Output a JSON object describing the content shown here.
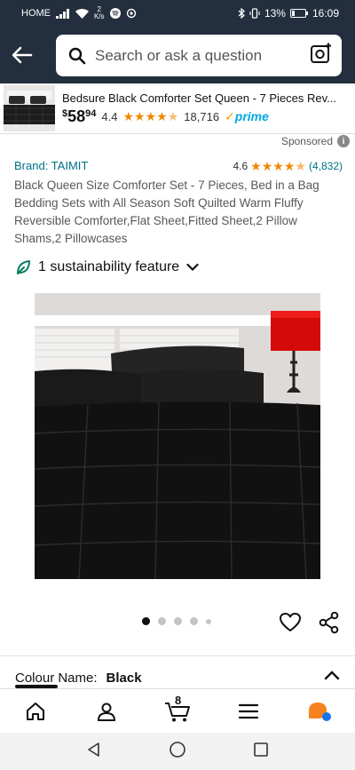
{
  "status_bar": {
    "carrier": "HOME",
    "net_speed_value": "2",
    "net_speed_unit": "K/s",
    "battery": "13%",
    "time": "16:09"
  },
  "search": {
    "placeholder": "Search or ask a question"
  },
  "sticky_product": {
    "title": "Bedsure Black Comforter Set Queen - 7 Pieces Rev...",
    "price_currency": "$",
    "price_whole": "58",
    "price_fraction": "94",
    "rating": "4.4",
    "rating_value": 4.4,
    "review_count": "18,716",
    "prime_label": "prime"
  },
  "sponsored": {
    "label": "Sponsored"
  },
  "product": {
    "brand": "Brand: TAIMIT",
    "rating": "4.6",
    "rating_value": 4.6,
    "review_count": "(4,832)",
    "title": "Black Queen Size Comforter Set - 7 Pieces, Bed in a Bag Bedding Sets with All Season Soft Quilted Warm Fluffy Reversible Comforter,Flat Sheet,Fitted Sheet,2 Pillow Shams,2 Pillowcases",
    "sustainability": "1 sustainability feature"
  },
  "carousel": {
    "total_dots": 5,
    "active_index": 0
  },
  "colour": {
    "label": "Colour Name:",
    "value": "Black"
  },
  "bottom_nav": {
    "cart_count": "8",
    "items": [
      "home-icon",
      "account-icon",
      "cart-icon",
      "menu-icon",
      "rufus-icon"
    ]
  },
  "colors": {
    "header_bg": "#232f3e",
    "link": "#007185",
    "star": "#f08804",
    "prime_blue": "#00a8e1",
    "sustain_green": "#067d62"
  }
}
